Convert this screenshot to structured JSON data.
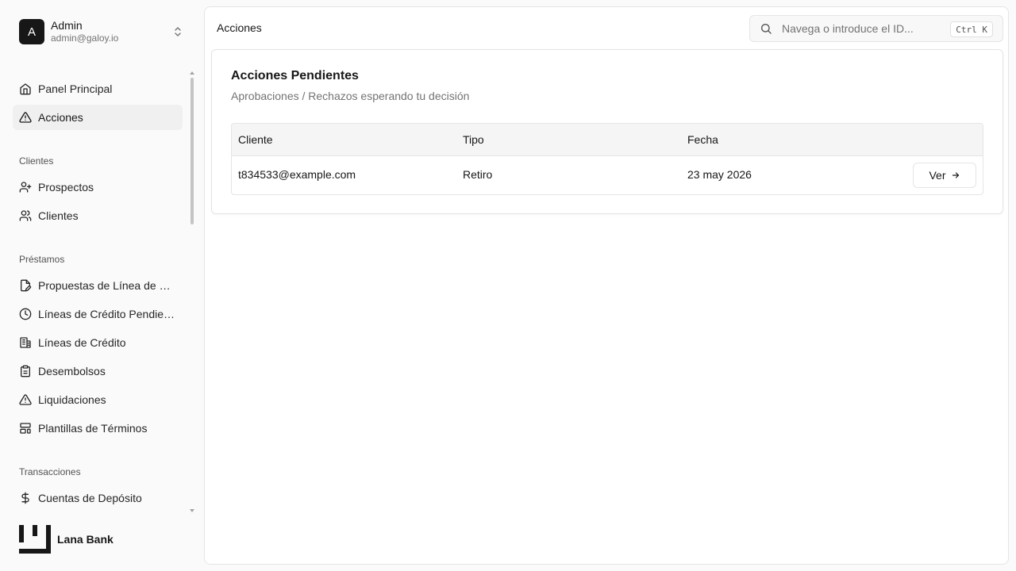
{
  "sidebar": {
    "user": {
      "initial": "A",
      "name": "Admin",
      "email": "admin@galoy.io"
    },
    "primary": [
      {
        "label": "Panel Principal",
        "icon": "home-icon"
      },
      {
        "label": "Acciones",
        "icon": "alert-triangle-icon",
        "active": true
      }
    ],
    "sections": [
      {
        "title": "Clientes",
        "items": [
          {
            "label": "Prospectos",
            "icon": "user-plus-icon"
          },
          {
            "label": "Clientes",
            "icon": "users-icon"
          }
        ]
      },
      {
        "title": "Préstamos",
        "items": [
          {
            "label": "Propuestas de Línea de Crédito",
            "icon": "file-edit-icon"
          },
          {
            "label": "Líneas de Crédito Pendientes",
            "icon": "clock-icon"
          },
          {
            "label": "Líneas de Crédito",
            "icon": "building-icon"
          },
          {
            "label": "Desembolsos",
            "icon": "clipboard-icon"
          },
          {
            "label": "Liquidaciones",
            "icon": "alert-triangle-icon"
          },
          {
            "label": "Plantillas de Términos",
            "icon": "layout-template-icon"
          }
        ]
      },
      {
        "title": "Transacciones",
        "items": [
          {
            "label": "Cuentas de Depósito",
            "icon": "dollar-icon"
          }
        ]
      }
    ],
    "brand": {
      "name": "Lana Bank"
    }
  },
  "header": {
    "title": "Acciones",
    "search": {
      "placeholder": "Navega o introduce el ID...",
      "shortcut": "Ctrl K"
    }
  },
  "main": {
    "card": {
      "title": "Acciones Pendientes",
      "subtitle": "Aprobaciones / Rechazos esperando tu decisión",
      "table": {
        "columns": [
          "Cliente",
          "Tipo",
          "Fecha"
        ],
        "rows": [
          {
            "client": "t834533@example.com",
            "type": "Retiro",
            "date": "23 may 2026",
            "action": "Ver"
          }
        ]
      }
    }
  },
  "colors": {
    "accent": "#171717",
    "active_bg": "#f0f0f0",
    "border": "#e5e5e5",
    "muted_text": "#737373"
  }
}
